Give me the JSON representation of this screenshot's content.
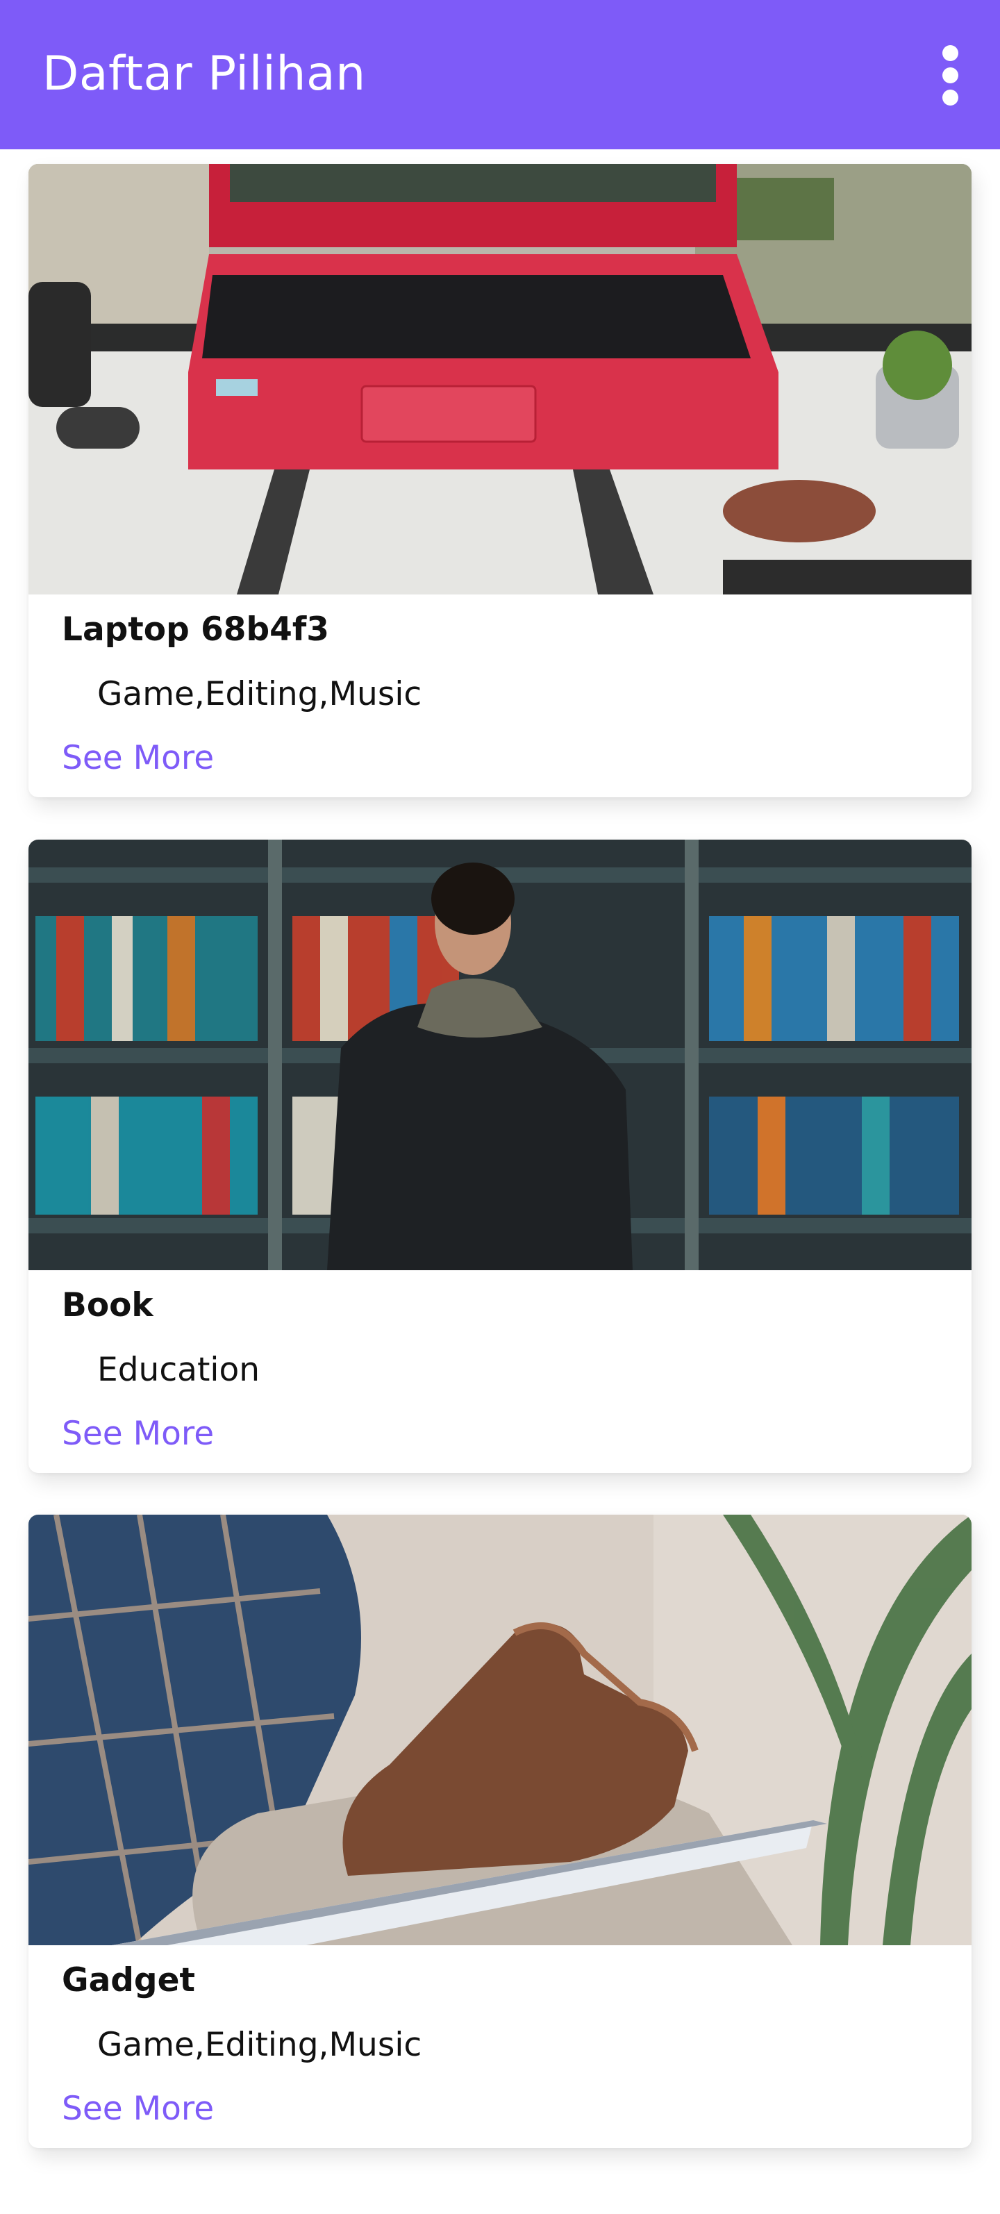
{
  "app_bar": {
    "title": "Daftar Pilihan",
    "menu_icon": "more-vertical-icon",
    "background_color": "#7e5bf8"
  },
  "accent_color": "#7e5bf8",
  "items": [
    {
      "title": "Laptop 68b4f3",
      "tags": "Game,Editing,Music",
      "link_label": "See More",
      "image_alt": "red laptop on desk"
    },
    {
      "title": "Book",
      "tags": "Education",
      "link_label": "See More",
      "image_alt": "man browsing library bookshelves"
    },
    {
      "title": "Gadget",
      "tags": "Game,Editing,Music",
      "link_label": "See More",
      "image_alt": "hand touching a tablet"
    }
  ]
}
